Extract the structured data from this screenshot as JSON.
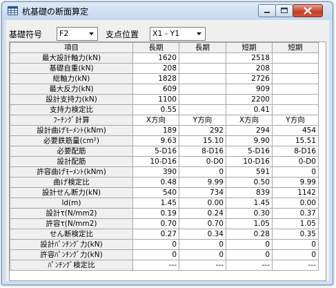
{
  "window": {
    "title": "杭基礎の断面算定"
  },
  "controls": {
    "foundation_label": "基礎符号",
    "foundation_value": "F2",
    "support_label": "支点位置",
    "support_value": "X1 - Y1"
  },
  "colors": {
    "titlebar": "#c4d8ef",
    "close_button": "#c43c24",
    "header_bg": "#f0f0f0"
  },
  "icons": [
    "table-icon",
    "minimize-icon",
    "maximize-icon",
    "close-icon",
    "chevron-down-icon"
  ],
  "table": {
    "headers": [
      "項目",
      "長期",
      "長期",
      "短期",
      "短期"
    ],
    "rows": [
      {
        "label": "最大設計軸力(kN)",
        "cells": [
          "1620",
          "",
          "2518",
          ""
        ]
      },
      {
        "label": "基礎自重(kN)",
        "cells": [
          "208",
          "",
          "208",
          ""
        ]
      },
      {
        "label": "総軸力(kN)",
        "cells": [
          "1828",
          "",
          "2726",
          ""
        ]
      },
      {
        "label": "最大反力(kN)",
        "cells": [
          "609",
          "",
          "909",
          ""
        ]
      },
      {
        "label": "設計支持力(kN)",
        "cells": [
          "1100",
          "",
          "2200",
          ""
        ]
      },
      {
        "label": "支持力検定比",
        "cells": [
          "0.55",
          "",
          "0.41",
          ""
        ]
      },
      {
        "label": "ﾌｰﾁﾝｸﾞ計算",
        "cells": [
          "X方向",
          "Y方向",
          "X方向",
          "Y方向"
        ],
        "centered": true
      },
      {
        "label": "設計曲げﾓｰﾒﾝﾄ(kNm)",
        "cells": [
          "189",
          "292",
          "294",
          "454"
        ]
      },
      {
        "label": "必要鉄筋量(cm²)",
        "cells": [
          "9.63",
          "15.10",
          "9.90",
          "15.51"
        ]
      },
      {
        "label": "必要配筋",
        "cells": [
          "5-D16",
          "8-D16",
          "5-D16",
          "8-D16"
        ]
      },
      {
        "label": "設計配筋",
        "cells": [
          "10-D16",
          "0-D0",
          "10-D16",
          "0-D0"
        ]
      },
      {
        "label": "許容曲げﾓｰﾒﾝﾄ(kNm)",
        "cells": [
          "390",
          "0",
          "591",
          "0"
        ]
      },
      {
        "label": "曲げ検定比",
        "cells": [
          "0.48",
          "9.99",
          "0.50",
          "9.99"
        ]
      },
      {
        "label": "設計せん断力(kN)",
        "cells": [
          "540",
          "734",
          "839",
          "1142"
        ]
      },
      {
        "label": "ld(m)",
        "cells": [
          "1.45",
          "0.00",
          "1.45",
          "0.00"
        ]
      },
      {
        "label": "設計τ(N/mm2)",
        "cells": [
          "0.19",
          "0.24",
          "0.30",
          "0.37"
        ]
      },
      {
        "label": "許容τ(N/mm2)",
        "cells": [
          "0.70",
          "0.70",
          "1.05",
          "1.05"
        ]
      },
      {
        "label": "せん断検定比",
        "cells": [
          "0.27",
          "0.34",
          "0.28",
          "0.35"
        ]
      },
      {
        "label": "設計ﾊﾟﾝﾁﾝｸﾞ力(kN)",
        "cells": [
          "0",
          "0",
          "0",
          "0"
        ]
      },
      {
        "label": "許容ﾊﾟﾝﾁﾝｸﾞ力(kN)",
        "cells": [
          "0",
          "0",
          "0",
          "0"
        ]
      },
      {
        "label": "ﾊﾟﾝﾁﾝｸﾞ検定比",
        "cells": [
          "---",
          "---",
          "---",
          "---"
        ]
      }
    ]
  }
}
